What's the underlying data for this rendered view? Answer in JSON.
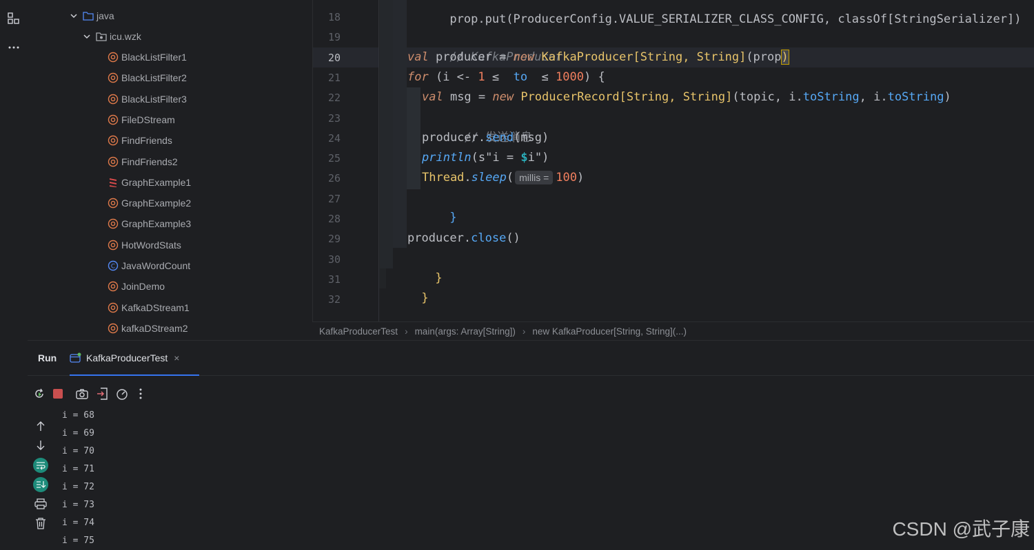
{
  "activity_bar": {
    "icons": [
      "structure-icon",
      "more-icon"
    ]
  },
  "project_tree": {
    "folders": [
      {
        "label": "java",
        "expanded": true
      },
      {
        "label": "icu.wzk",
        "expanded": true
      }
    ],
    "files": [
      {
        "label": "BlackListFilter1",
        "kind": "object"
      },
      {
        "label": "BlackListFilter2",
        "kind": "object"
      },
      {
        "label": "BlackListFilter3",
        "kind": "object"
      },
      {
        "label": "FileDStream",
        "kind": "object"
      },
      {
        "label": "FindFriends",
        "kind": "object"
      },
      {
        "label": "FindFriends2",
        "kind": "object"
      },
      {
        "label": "GraphExample1",
        "kind": "scala"
      },
      {
        "label": "GraphExample2",
        "kind": "object"
      },
      {
        "label": "GraphExample3",
        "kind": "object"
      },
      {
        "label": "HotWordStats",
        "kind": "object"
      },
      {
        "label": "JavaWordCount",
        "kind": "class"
      },
      {
        "label": "JoinDemo",
        "kind": "object"
      },
      {
        "label": "KafkaDStream1",
        "kind": "object"
      },
      {
        "label": "kafkaDStream2",
        "kind": "object"
      }
    ]
  },
  "editor": {
    "current_line": "20",
    "line_numbers": [
      "18",
      "19",
      "20",
      "21",
      "22",
      "23",
      "24",
      "25",
      "26",
      "27",
      "28",
      "29",
      "30",
      "31",
      "32"
    ],
    "code": {
      "l17_partial": "prop.put(ProducerConfig.VALUE_SERIALIZER_CLASS_CONFIG, classOf[StringSerializer])",
      "l19_comment": "// KafkaProducer",
      "l20": {
        "kw": "val",
        "name": " producer = ",
        "new": "new",
        "type": " KafkaProducer[String, String]",
        "arg": "(prop",
        "close": ")"
      },
      "l21": {
        "kw": "for",
        "open": " (i <- ",
        "from": "1",
        "le1": " ≤ ",
        "to": " to ",
        "le2": " ≤ ",
        "until": "1000",
        "close": ") {"
      },
      "l22": {
        "kw": "val",
        "name": " msg = ",
        "new": "new",
        "type": " ProducerRecord[String, String]",
        "a1": "(topic, i.",
        "f1": "toString",
        "a2": ", i.",
        "f2": "toString",
        "a3": ")"
      },
      "l23_comment": "// 发送消息",
      "l24": {
        "obj": "producer.",
        "fn": "send",
        "args": "(msg)"
      },
      "l25": {
        "fn": "println",
        "s1": "(s",
        "q1": "\"i = ",
        "dollar": "$",
        "q2": "i\"",
        "close": ")"
      },
      "l26": {
        "type": "Thread",
        "dot": ".",
        "fn": "sleep",
        "open": "(",
        "hint": "millis =",
        "num": "100",
        "close": ")"
      },
      "l27": "}",
      "l29": {
        "obj": "producer.",
        "fn": "close",
        "args": "()"
      },
      "l30": "}",
      "l31": "}"
    }
  },
  "breadcrumb": [
    "KafkaProducerTest",
    "main(args: Array[String])",
    "new KafkaProducer[String, String](...)"
  ],
  "breadcrumb_sep": "›",
  "run": {
    "title": "Run",
    "tab_label": "KafkaProducerTest",
    "tab_close": "×",
    "toolbar_icons": [
      "rerun-icon",
      "stop-icon",
      "screenshot-icon",
      "exit-icon",
      "profiler-icon",
      "more-icon"
    ],
    "side_icons": [
      "up-arrow-icon",
      "down-arrow-icon",
      "soft-wrap-icon",
      "scroll-to-end-icon",
      "print-icon",
      "trash-icon"
    ],
    "output": [
      "i = 68",
      "i = 69",
      "i = 70",
      "i = 71",
      "i = 72",
      "i = 73",
      "i = 74",
      "i = 75"
    ]
  },
  "watermark": "CSDN @武子康",
  "colors": {
    "background": "#1e1f22",
    "keyword": "#cf8e6d",
    "type": "#e8c46a",
    "accent": "#3574f0",
    "number": "#f17f5e",
    "stop_red": "#c94f4f",
    "teal_badge": "#1d8b7a"
  }
}
